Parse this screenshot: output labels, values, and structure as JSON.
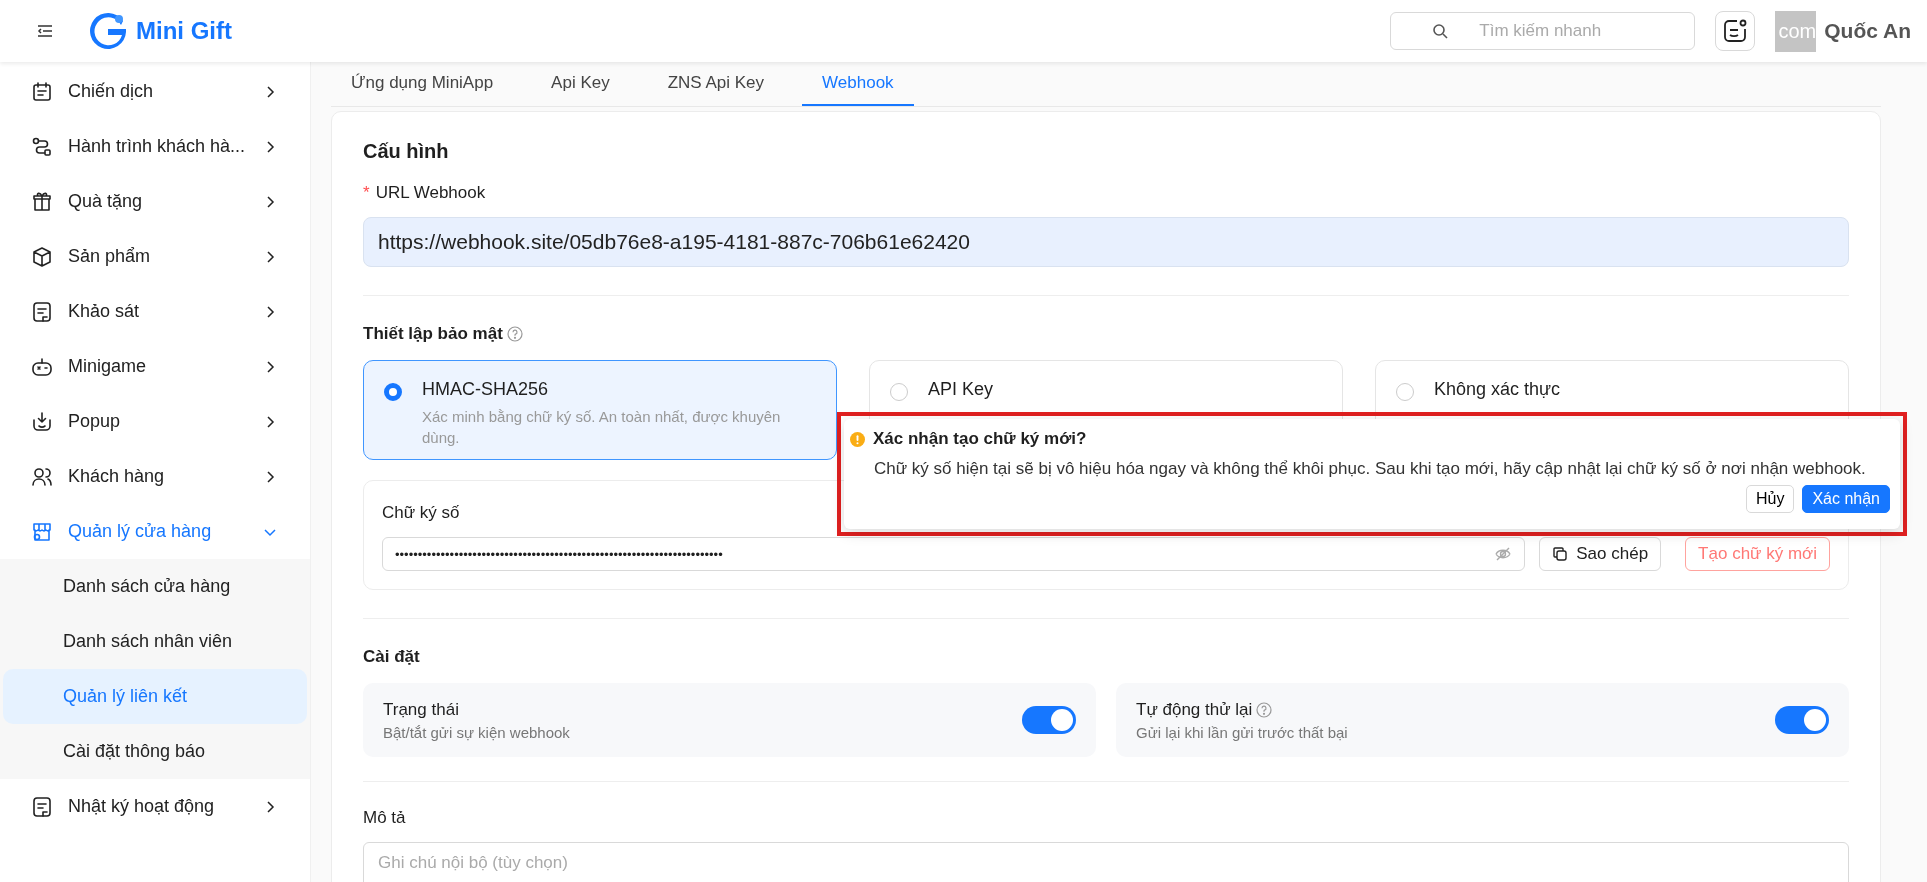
{
  "header": {
    "logo_text": "Mini Gift",
    "search": {
      "placeholder": "Tìm kiếm nhanh"
    },
    "user": {
      "avatar_text": "com",
      "name": "Quốc An"
    }
  },
  "sidebar": {
    "items": [
      {
        "label": "Chiến dịch",
        "expanded": false,
        "selected": false
      },
      {
        "label": "Hành trình khách hà...",
        "expanded": false,
        "selected": false
      },
      {
        "label": "Quà tặng",
        "expanded": false,
        "selected": false
      },
      {
        "label": "Sản phẩm",
        "expanded": false,
        "selected": false
      },
      {
        "label": "Khảo sát",
        "expanded": false,
        "selected": false
      },
      {
        "label": "Minigame",
        "expanded": false,
        "selected": false
      },
      {
        "label": "Popup",
        "expanded": false,
        "selected": false
      },
      {
        "label": "Khách hàng",
        "expanded": false,
        "selected": false
      },
      {
        "label": "Quản lý cửa hàng",
        "expanded": true,
        "selected": true,
        "children": [
          {
            "label": "Danh sách cửa hàng",
            "selected": false
          },
          {
            "label": "Danh sách nhân viên",
            "selected": false
          },
          {
            "label": "Quản lý liên kết",
            "selected": true
          },
          {
            "label": "Cài đặt thông báo",
            "selected": false
          }
        ]
      },
      {
        "label": "Nhật ký hoạt động",
        "expanded": false,
        "selected": false
      }
    ]
  },
  "tabs": [
    {
      "label": "Ứng dụng MiniApp",
      "selected": false
    },
    {
      "label": "Api Key",
      "selected": false
    },
    {
      "label": "ZNS Api Key",
      "selected": false
    },
    {
      "label": "Webhook",
      "selected": true
    }
  ],
  "config": {
    "title": "Cấu hình",
    "url_field": {
      "label": "URL Webhook",
      "required_mark": "*",
      "value": "https://webhook.site/05db76e8-a195-4181-887c-706b61e62420"
    },
    "security": {
      "label": "Thiết lập bảo mật",
      "options": [
        {
          "label": "HMAC-SHA256",
          "description": "Xác minh bằng chữ ký số. An toàn nhất, được khuyên dùng.",
          "selected": true
        },
        {
          "label": "API Key",
          "selected": false
        },
        {
          "label": "Không xác thực",
          "selected": false
        }
      ],
      "signature": {
        "label": "Chữ ký số",
        "value": "••••••••••••••••••••••••••••••••••••••••••••••••••••••••••••••••••••••••",
        "copy_button": "Sao chép",
        "regenerate_button": "Tạo chữ ký mới"
      }
    },
    "popconfirm": {
      "title": "Xác nhận tạo chữ ký mới?",
      "message": "Chữ ký số hiện tại sẽ bị vô hiệu hóa ngay và không thể khôi phục. Sau khi tạo mới, hãy cập nhật lại chữ ký số ở nơi nhận webhook.",
      "cancel_button": "Hủy",
      "confirm_button": "Xác nhận"
    },
    "settings": {
      "title": "Cài đặt",
      "toggles": [
        {
          "label": "Trạng thái",
          "description": "Bật/tắt gửi sự kiện webhook",
          "help": false,
          "on": true
        },
        {
          "label": "Tự động thử lại",
          "description": "Gửi lại khi lần gửi trước thất bại",
          "help": true,
          "on": true
        }
      ]
    },
    "description_field": {
      "label": "Mô tả",
      "placeholder": "Ghi chú nội bộ (tùy chọn)"
    }
  }
}
